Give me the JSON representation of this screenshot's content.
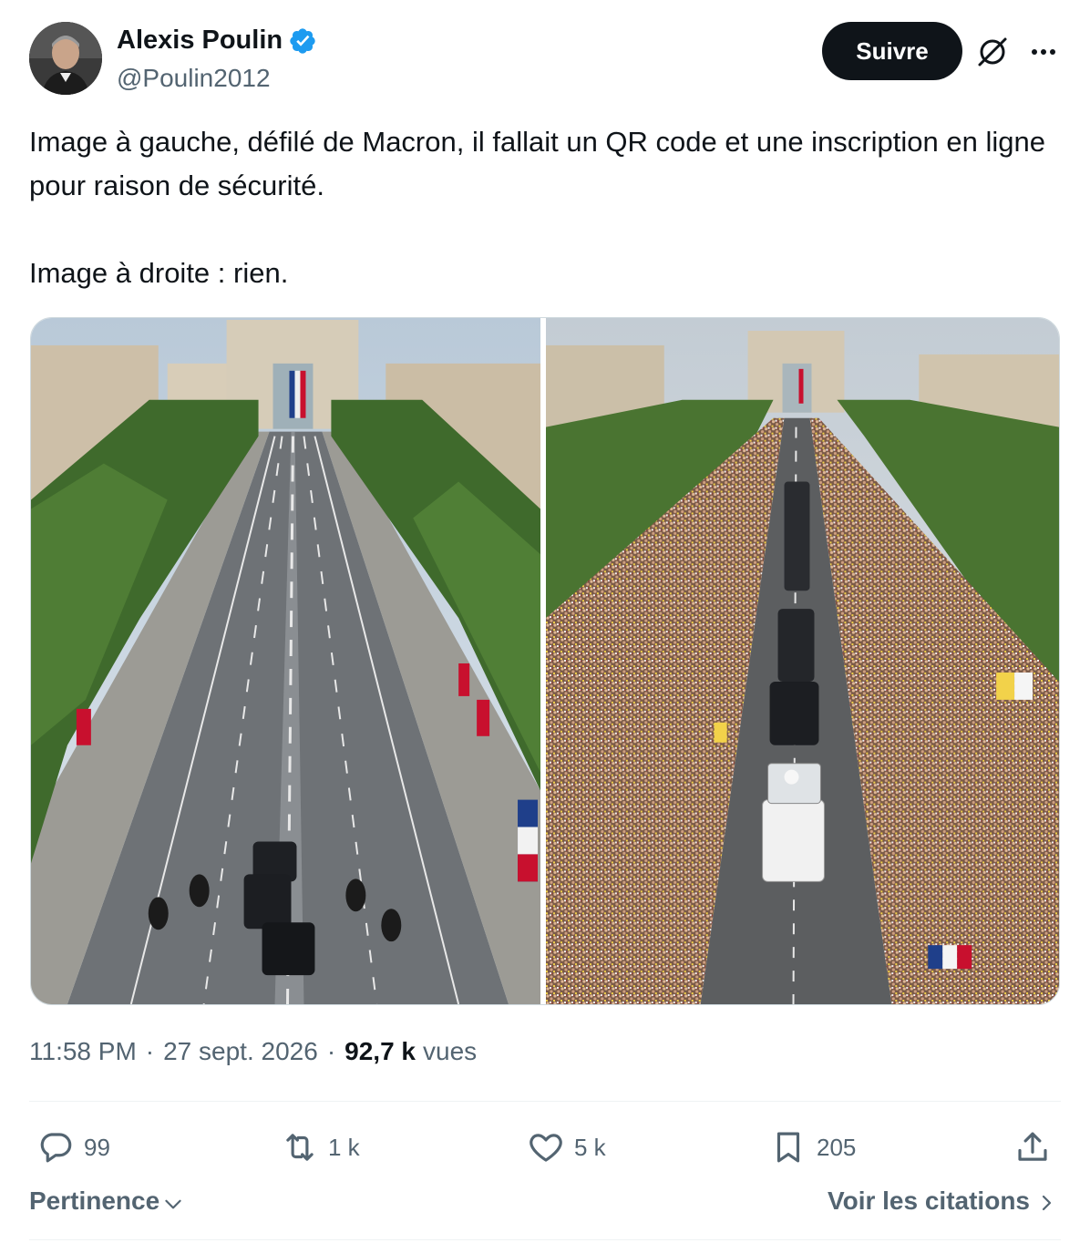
{
  "author": {
    "name": "Alexis Poulin",
    "handle": "@Poulin2012",
    "verified": true
  },
  "header": {
    "follow_label": "Suivre",
    "grok_icon": "grok-icon",
    "more_icon": "more-icon"
  },
  "tweet": {
    "line1": "Image à gauche, défilé de Macron, il fallait un QR code et une inscription en ligne pour raison de sécurité.",
    "line2": "Image à droite : rien."
  },
  "media": {
    "left": {
      "subject": "empty-avenue-motorcade"
    },
    "right": {
      "subject": "crowded-avenue-popemobile"
    }
  },
  "meta": {
    "time": "11:58 PM",
    "sep1": "·",
    "date": "27 sept. 2026",
    "sep2": "·",
    "views_count": "92,7 k",
    "views_label": "vues"
  },
  "actions": {
    "replies": "99",
    "reposts": "1 k",
    "likes": "5 k",
    "bookmarks": "205"
  },
  "footer": {
    "sort_label": "Pertinence",
    "quotes_label": "Voir les citations"
  },
  "colors": {
    "text": "#0f1419",
    "muted": "#536471",
    "verified": "#1d9bf0",
    "button_bg": "#0f1419",
    "divider": "#eff3f4"
  }
}
